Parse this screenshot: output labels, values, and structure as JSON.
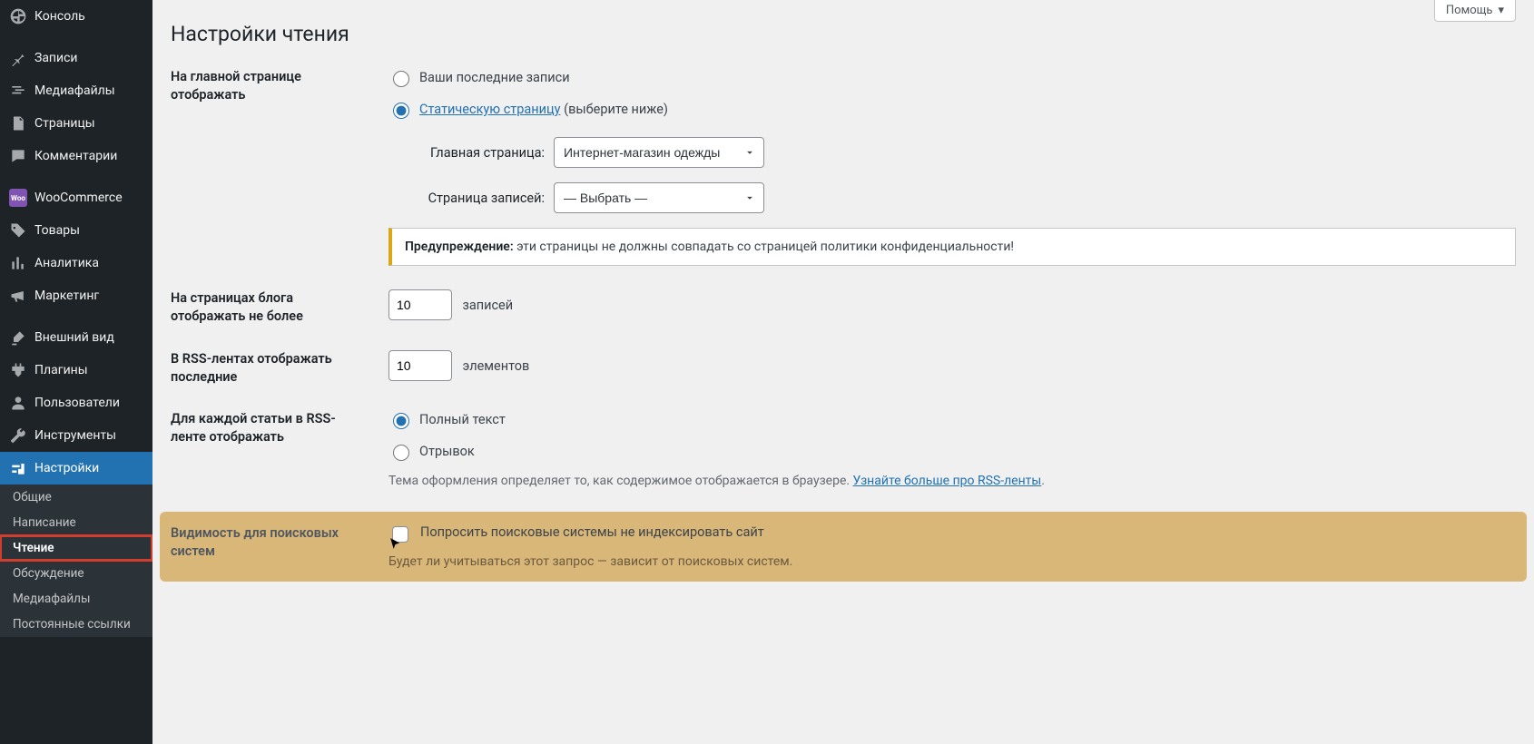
{
  "help": {
    "label": "Помощь"
  },
  "sidebar": {
    "items": [
      {
        "label": "Консоль",
        "icon": "dashboard"
      },
      {
        "label": "Записи",
        "icon": "pin"
      },
      {
        "label": "Медиафайлы",
        "icon": "media"
      },
      {
        "label": "Страницы",
        "icon": "page"
      },
      {
        "label": "Комментарии",
        "icon": "comment"
      },
      {
        "label": "WooCommerce",
        "icon": "woo"
      },
      {
        "label": "Товары",
        "icon": "tag"
      },
      {
        "label": "Аналитика",
        "icon": "chart"
      },
      {
        "label": "Маркетинг",
        "icon": "megaphone"
      },
      {
        "label": "Внешний вид",
        "icon": "brush"
      },
      {
        "label": "Плагины",
        "icon": "plugin"
      },
      {
        "label": "Пользователи",
        "icon": "user"
      },
      {
        "label": "Инструменты",
        "icon": "wrench"
      },
      {
        "label": "Настройки",
        "icon": "settings",
        "active": true
      }
    ],
    "submenu": [
      {
        "label": "Общие"
      },
      {
        "label": "Написание"
      },
      {
        "label": "Чтение",
        "current": true
      },
      {
        "label": "Обсуждение"
      },
      {
        "label": "Медиафайлы"
      },
      {
        "label": "Постоянные ссылки"
      }
    ]
  },
  "page": {
    "title": "Настройки чтения",
    "front": {
      "heading": "На главной странице отображать",
      "opt_posts": "Ваши последние записи",
      "opt_static_link": "Статическую страницу",
      "opt_static_paren": "(выберите ниже)",
      "homepage_label": "Главная страница:",
      "homepage_value": "Интернет-магазин одежды",
      "posts_page_label": "Страница записей:",
      "posts_page_value": "— Выбрать —",
      "warning_strong": "Предупреждение:",
      "warning_text": " эти страницы не должны совпадать со страницей политики конфиденциальности!"
    },
    "blog_pages": {
      "heading": "На страницах блога отображать не более",
      "value": "10",
      "suffix": "записей"
    },
    "rss_items": {
      "heading": "В RSS-лентах отображать последние",
      "value": "10",
      "suffix": "элементов"
    },
    "rss_content": {
      "heading": "Для каждой статьи в RSS-ленте отображать",
      "opt_full": "Полный текст",
      "opt_excerpt": "Отрывок",
      "desc_prefix": "Тема оформления определяет то, как содержимое отображается в браузере. ",
      "desc_link": "Узнайте больше про RSS-ленты",
      "desc_suffix": "."
    },
    "search_vis": {
      "heading": "Видимость для поисковых систем",
      "checkbox_label": "Попросить поисковые системы не индексировать сайт",
      "desc": "Будет ли учитываться этот запрос — зависит от поисковых систем."
    }
  }
}
